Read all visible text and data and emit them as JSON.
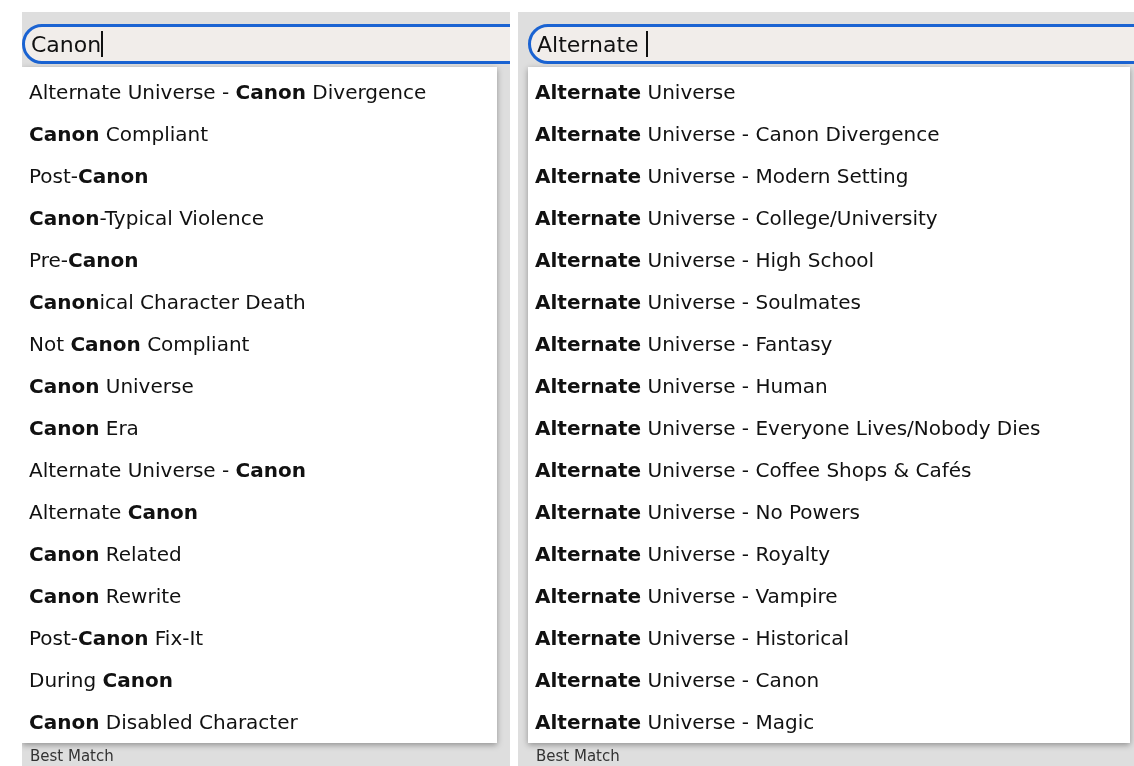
{
  "panels": [
    {
      "query": "Canon",
      "suggestions": [
        "Alternate Universe - **Canon** Divergence",
        "**Canon** Compliant",
        "Post-**Canon**",
        "**Canon**-Typical Violence",
        "Pre-**Canon**",
        "**Canon**ical Character Death",
        "Not **Canon** Compliant",
        "**Canon** Universe",
        "**Canon** Era",
        "Alternate Universe - **Canon**",
        "Alternate **Canon**",
        "**Canon** Related",
        "**Canon** Rewrite",
        "Post-**Canon** Fix-It",
        "During **Canon**",
        "**Canon** Disabled Character"
      ],
      "below_label": "Best Match"
    },
    {
      "query": "Alternate ",
      "suggestions": [
        "**Alternate** Universe",
        "**Alternate** Universe - Canon Divergence",
        "**Alternate** Universe - Modern Setting",
        "**Alternate** Universe - College/University",
        "**Alternate** Universe - High School",
        "**Alternate** Universe - Soulmates",
        "**Alternate** Universe - Fantasy",
        "**Alternate** Universe - Human",
        "**Alternate** Universe - Everyone Lives/Nobody Dies",
        "**Alternate** Universe - Coffee Shops & Cafés",
        "**Alternate** Universe - No Powers",
        "**Alternate** Universe - Royalty",
        "**Alternate** Universe - Vampire",
        "**Alternate** Universe - Historical",
        "**Alternate** Universe - Canon",
        "**Alternate** Universe - Magic"
      ],
      "below_label": "Best Match"
    }
  ]
}
